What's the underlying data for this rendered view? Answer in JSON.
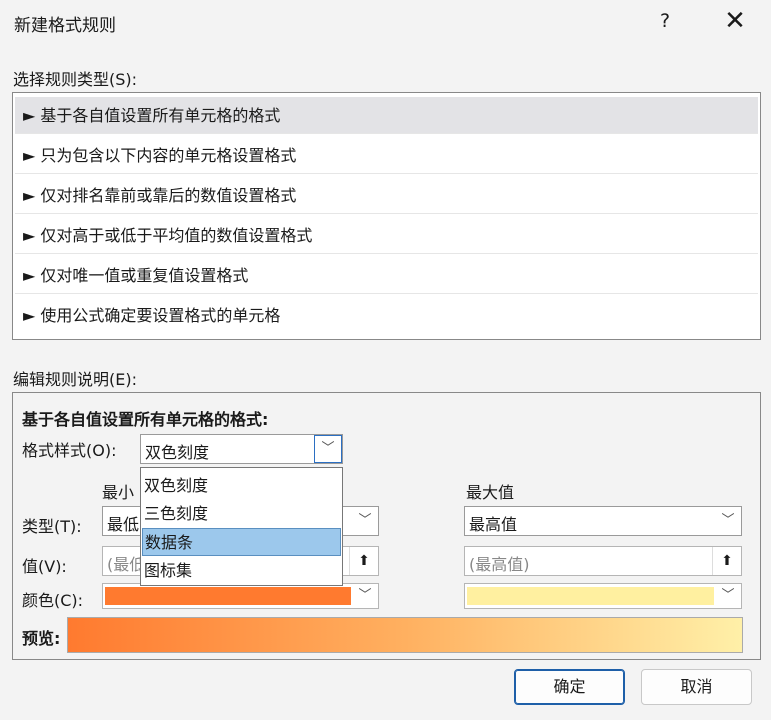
{
  "window": {
    "title": "新建格式规则",
    "help": "?",
    "close": "✕"
  },
  "rule_type_label": "选择规则类型(S):",
  "rules": [
    "► 基于各自值设置所有单元格的格式",
    "► 只为包含以下内容的单元格设置格式",
    "► 仅对排名靠前或靠后的数值设置格式",
    "► 仅对高于或低于平均值的数值设置格式",
    "► 仅对唯一值或重复值设置格式",
    "► 使用公式确定要设置格式的单元格"
  ],
  "edit_label": "编辑规则说明(E):",
  "edit": {
    "heading": "基于各自值设置所有单元格的格式:",
    "format_style_label": "格式样式(O):",
    "format_style_value": "双色刻度",
    "min_header": "最小",
    "max_header": "最大值",
    "type_label": "类型(T):",
    "min_type": "最低",
    "max_type": "最高值",
    "value_label": "值(V):",
    "min_value_placeholder": "(最低",
    "max_value_placeholder": "(最高值)",
    "color_label": "颜色(C):",
    "preview_label": "预览:"
  },
  "colors": {
    "min": "#ff7a2f",
    "max": "#fff0a0",
    "selection": "#9cc8ec"
  },
  "dropdown_options": [
    "双色刻度",
    "三色刻度",
    "数据条",
    "图标集"
  ],
  "buttons": {
    "ok": "确定",
    "cancel": "取消"
  },
  "icons": {
    "dropdown": "chevron-down-icon",
    "upload": "arrow-up-icon"
  }
}
